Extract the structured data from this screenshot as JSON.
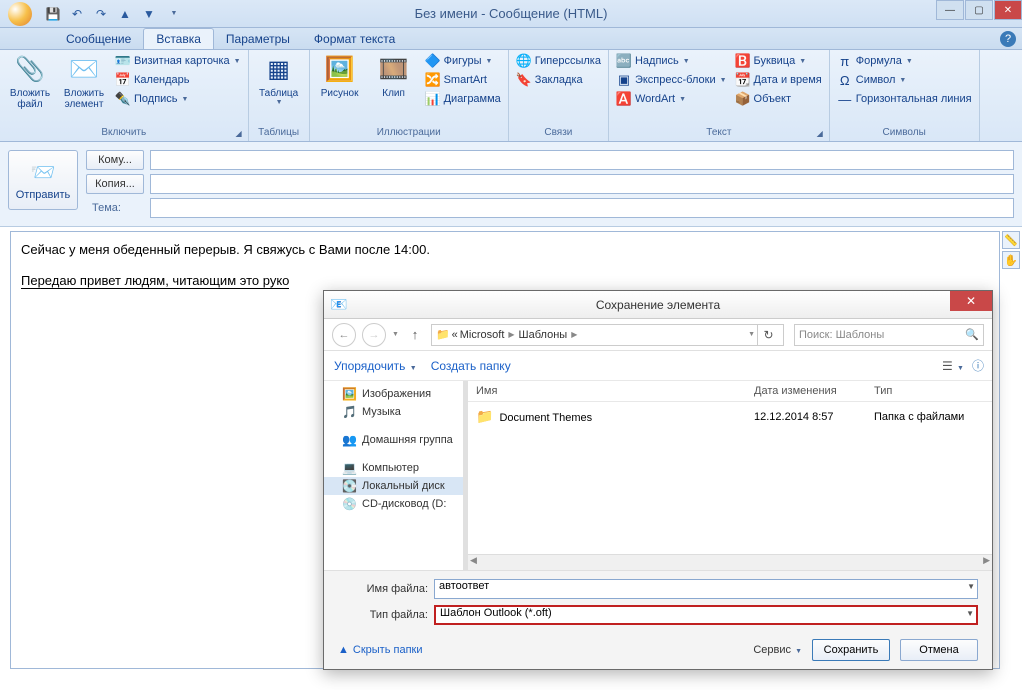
{
  "titlebar": {
    "title": "Без имени - Сообщение (HTML)"
  },
  "ribbon_tabs": {
    "t1": "Сообщение",
    "t2": "Вставка",
    "t3": "Параметры",
    "t4": "Формат текста"
  },
  "ribbon": {
    "include": {
      "attach_file": "Вложить файл",
      "attach_item": "Вложить элемент",
      "business_card": "Визитная карточка",
      "calendar": "Календарь",
      "signature": "Подпись",
      "label": "Включить"
    },
    "tables": {
      "table": "Таблица",
      "label": "Таблицы"
    },
    "illus": {
      "picture": "Рисунок",
      "clip": "Клип",
      "shapes": "Фигуры",
      "smartart": "SmartArt",
      "chart": "Диаграмма",
      "label": "Иллюстрации"
    },
    "links": {
      "hyperlink": "Гиперссылка",
      "bookmark": "Закладка",
      "label": "Связи"
    },
    "text": {
      "textbox": "Надпись",
      "quickparts": "Экспресс-блоки",
      "wordart": "WordArt",
      "dropcap": "Буквица",
      "datetime": "Дата и время",
      "object": "Объект",
      "label": "Текст"
    },
    "symbols": {
      "equation": "Формула",
      "symbol": "Символ",
      "hline": "Горизонтальная линия",
      "label": "Символы"
    }
  },
  "compose": {
    "send": "Отправить",
    "to": "Кому...",
    "cc": "Копия...",
    "subject": "Тема:"
  },
  "body": {
    "line1": "Сейчас у меня обеденный перерыв. Я свяжусь с Вами после 14:00.",
    "line2": "Передаю привет людям, читающим это руко"
  },
  "dialog": {
    "title": "Сохранение элемента",
    "crumb_prefix": "«",
    "crumb1": "Microsoft",
    "crumb2": "Шаблоны",
    "search_ph": "Поиск: Шаблоны",
    "organize": "Упорядочить",
    "newfolder": "Создать папку",
    "tree": {
      "pictures": "Изображения",
      "music": "Музыка",
      "homegroup": "Домашняя группа",
      "computer": "Компьютер",
      "localdisk": "Локальный диск",
      "cddrive": "CD-дисковод (D:"
    },
    "cols": {
      "name": "Имя",
      "date": "Дата изменения",
      "type": "Тип"
    },
    "row": {
      "name": "Document Themes",
      "date": "12.12.2014 8:57",
      "type": "Папка с файлами"
    },
    "filename_lbl": "Имя файла:",
    "filename_val": "автоответ",
    "filetype_lbl": "Тип файла:",
    "filetype_val": "Шаблон Outlook (*.oft)",
    "hide": "Скрыть папки",
    "service": "Сервис",
    "save": "Сохранить",
    "cancel": "Отмена"
  }
}
